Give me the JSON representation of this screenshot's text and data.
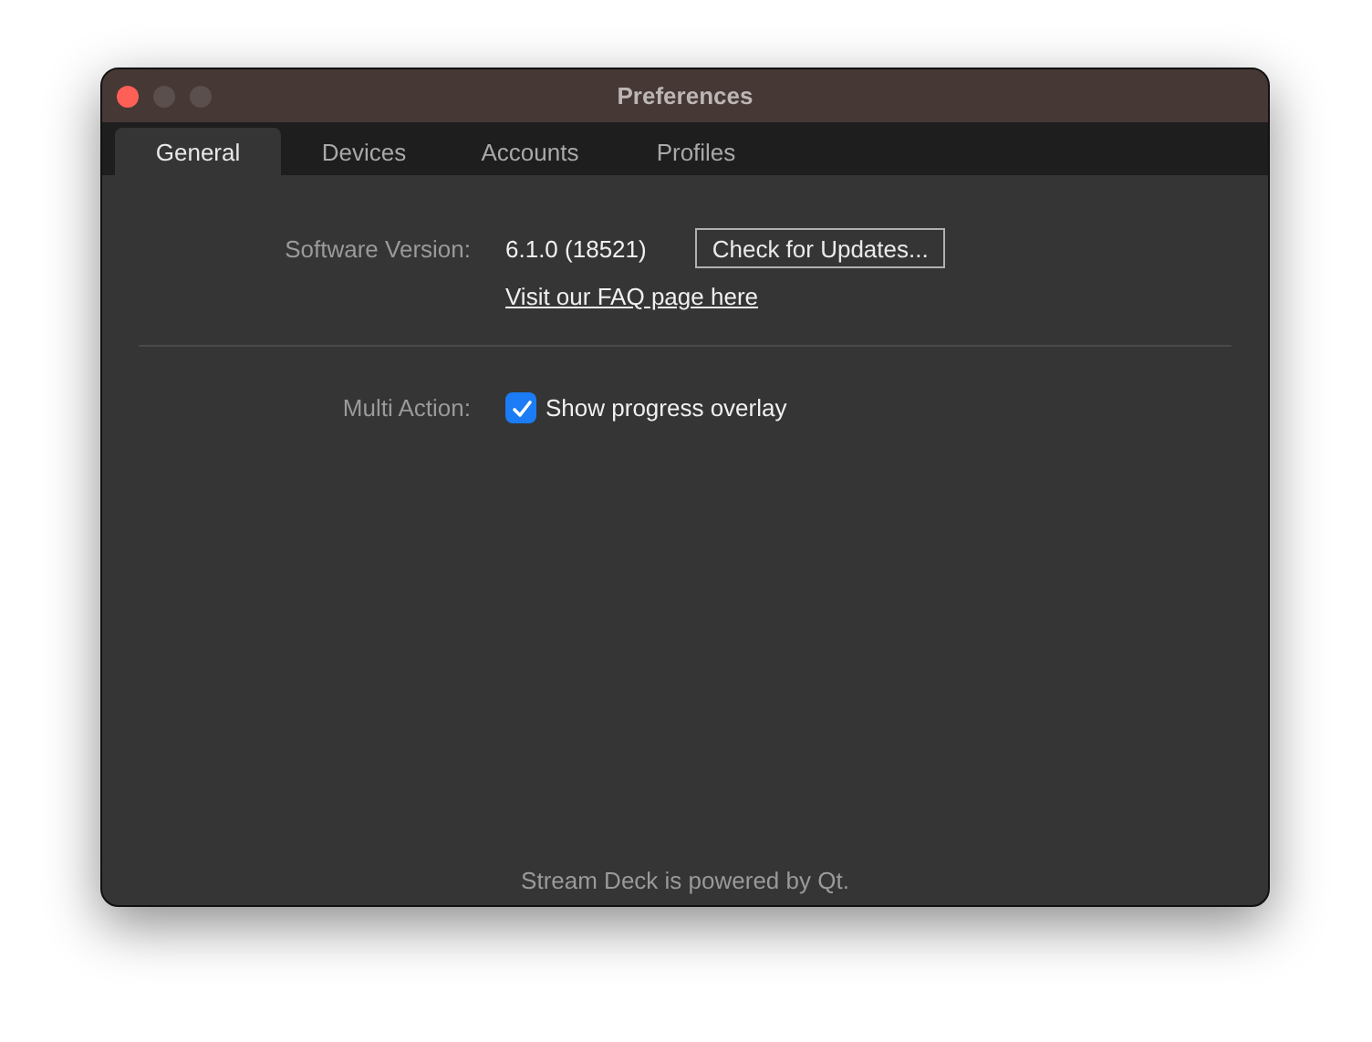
{
  "window": {
    "title": "Preferences"
  },
  "tabs": [
    {
      "label": "General",
      "selected": true
    },
    {
      "label": "Devices",
      "selected": false
    },
    {
      "label": "Accounts",
      "selected": false
    },
    {
      "label": "Profiles",
      "selected": false
    }
  ],
  "software_version": {
    "label": "Software Version:",
    "value": "6.1.0 (18521)",
    "button": "Check for Updates...",
    "link": "Visit our FAQ page here"
  },
  "multi_action": {
    "label": "Multi Action:",
    "checkbox": {
      "label": "Show progress overlay",
      "checked": true
    }
  },
  "footer": "Stream Deck is powered by Qt."
}
